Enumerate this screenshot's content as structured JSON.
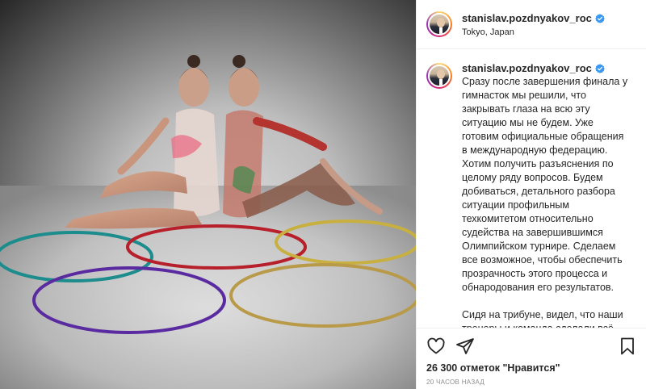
{
  "post": {
    "username": "stanislav.pozdnyakov_roc",
    "location": "Tokyo, Japan",
    "caption": {
      "paragraph_1": "Сразу после завершения финала у гимнасток мы решили, что закрывать глаза на всю эту ситуацию мы не будем. Уже готовим официальные обращения в международную федерацию. Хотим получить разъяснения по целому ряду вопросов. Будем добиваться, детального разбора ситуации профильным техкомитетом относительно судейства на завершившимся Олимпийском турнире. Сделаем все возможное, чтобы обеспечить прозрачность этого процесса и обнародования его результатов.",
      "paragraph_2": "Сидя на трибуне, видел, что наши тренеры и команда сделали всё возможное, предусмотренное"
    },
    "likes": "26 300 отметок \"Нравится\"",
    "time": "20 часов назад"
  },
  "icons": {
    "like": "heart-icon",
    "share": "paper-plane-icon",
    "save": "bookmark-icon",
    "verified": "verified-badge-icon"
  },
  "colors": {
    "verified": "#3897f0",
    "muted_text": "#8e8e8e",
    "border": "#efefef"
  }
}
